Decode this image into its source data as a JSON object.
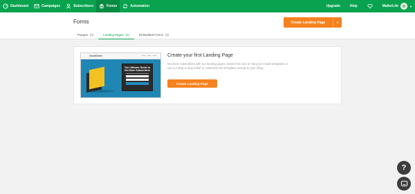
{
  "nav": {
    "items": [
      {
        "label": "Dashboard",
        "icon": "dashboard-icon"
      },
      {
        "label": "Campaigns",
        "icon": "mail-icon"
      },
      {
        "label": "Subscribers",
        "icon": "users-icon"
      },
      {
        "label": "Forms",
        "icon": "forms-icon",
        "active": true
      },
      {
        "label": "Automation",
        "icon": "automation-icon"
      }
    ],
    "right": {
      "upgrade": "Upgrade",
      "help": "Help",
      "account": "MailerLite"
    }
  },
  "header": {
    "title": "Forms",
    "create_button": "Create Landing Page",
    "tabs": [
      {
        "label": "Popups",
        "count": "(0)"
      },
      {
        "label": "Landing Pages",
        "count": "(1)",
        "active": true
      },
      {
        "label": "Embedded Forms",
        "count": "(2)"
      }
    ]
  },
  "card": {
    "title": "Create your first Landing Page",
    "description": "Get more subscribers with our landing pages. Select from one of many pre-made templates or use our drag & drop editor to customize the templates exactly to your liking.",
    "button": "Create Landing Page",
    "preview": {
      "logo": "CloudOnline",
      "form_title": "The Ultimate Guide to Get More Subscribers"
    }
  },
  "floating": {
    "help_glyph": "?"
  },
  "colors": {
    "nav_green": "#09a34f",
    "accent_orange": "#f5821f",
    "hero_blue": "#2086b4"
  }
}
